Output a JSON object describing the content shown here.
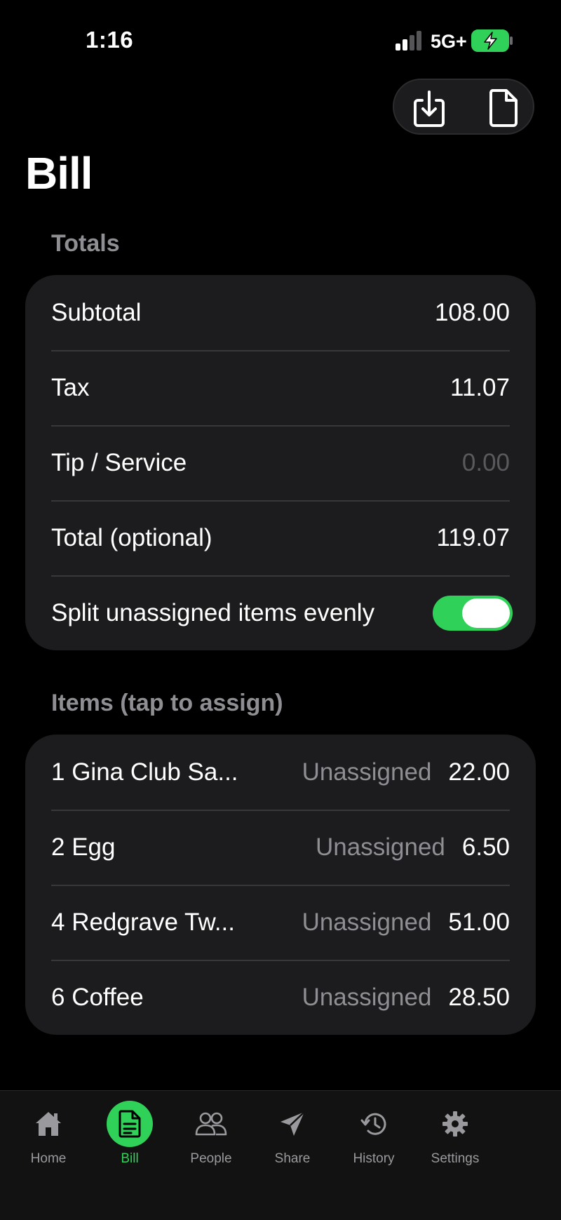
{
  "status_bar": {
    "time": "1:16",
    "network": "5G+",
    "signal_icon": "signal-bars-icon",
    "battery_icon": "battery-charging-icon"
  },
  "toolbar": {
    "download_icon": "tray-download-icon",
    "document_icon": "document-icon"
  },
  "page": {
    "title": "Bill"
  },
  "totals": {
    "header": "Totals",
    "subtotal_label": "Subtotal",
    "subtotal_value": "108.00",
    "tax_label": "Tax",
    "tax_value": "11.07",
    "tip_label": "Tip / Service",
    "tip_placeholder": "0.00",
    "total_label": "Total (optional)",
    "total_value": "119.07",
    "split_label": "Split unassigned items evenly",
    "split_enabled": true
  },
  "items": {
    "header": "Items (tap to assign)",
    "rows": [
      {
        "name": "1 Gina Club Sa...",
        "status": "Unassigned",
        "price": "22.00"
      },
      {
        "name": "2 Egg",
        "status": "Unassigned",
        "price": "6.50"
      },
      {
        "name": "4 Redgrave Tw...",
        "status": "Unassigned",
        "price": "51.00"
      },
      {
        "name": "6 Coffee",
        "status": "Unassigned",
        "price": "28.50"
      }
    ]
  },
  "tab_bar": {
    "active": "Bill",
    "tabs": [
      {
        "label": "Home",
        "icon": "house-icon"
      },
      {
        "label": "Bill",
        "icon": "receipt-icon"
      },
      {
        "label": "People",
        "icon": "people-icon"
      },
      {
        "label": "Share",
        "icon": "paper-plane-icon"
      },
      {
        "label": "History",
        "icon": "history-clock-icon"
      },
      {
        "label": "Settings",
        "icon": "gear-icon"
      }
    ]
  },
  "colors": {
    "accent": "#30d158",
    "background": "#000000",
    "card": "#1c1c1e",
    "secondary_text": "#8e8e93"
  }
}
